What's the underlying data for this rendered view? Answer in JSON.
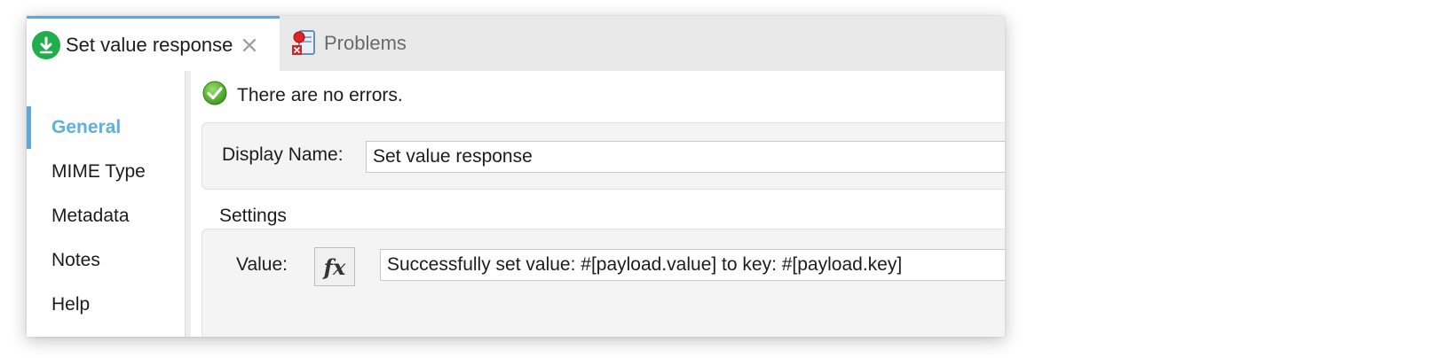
{
  "tabs": [
    {
      "label": "Set value response",
      "icon": "download-icon",
      "active": true
    },
    {
      "label": "Problems",
      "icon": "problems-icon",
      "active": false
    }
  ],
  "nav": {
    "items": [
      {
        "label": "General",
        "active": true
      },
      {
        "label": "MIME Type",
        "active": false
      },
      {
        "label": "Metadata",
        "active": false
      },
      {
        "label": "Notes",
        "active": false
      },
      {
        "label": "Help",
        "active": false
      }
    ]
  },
  "status": {
    "text": "There are no errors.",
    "icon": "check-icon"
  },
  "general": {
    "display_name_label": "Display Name:",
    "display_name_value": "Set value response"
  },
  "settings": {
    "title": "Settings",
    "value_label": "Value:",
    "fx_label": "fx",
    "value": "Successfully set value: #[payload.value] to key: #[payload.key]"
  },
  "colors": {
    "accent": "#5fa8d8",
    "active_nav_text": "#5fb0dc",
    "success_green": "#1fae4b"
  }
}
